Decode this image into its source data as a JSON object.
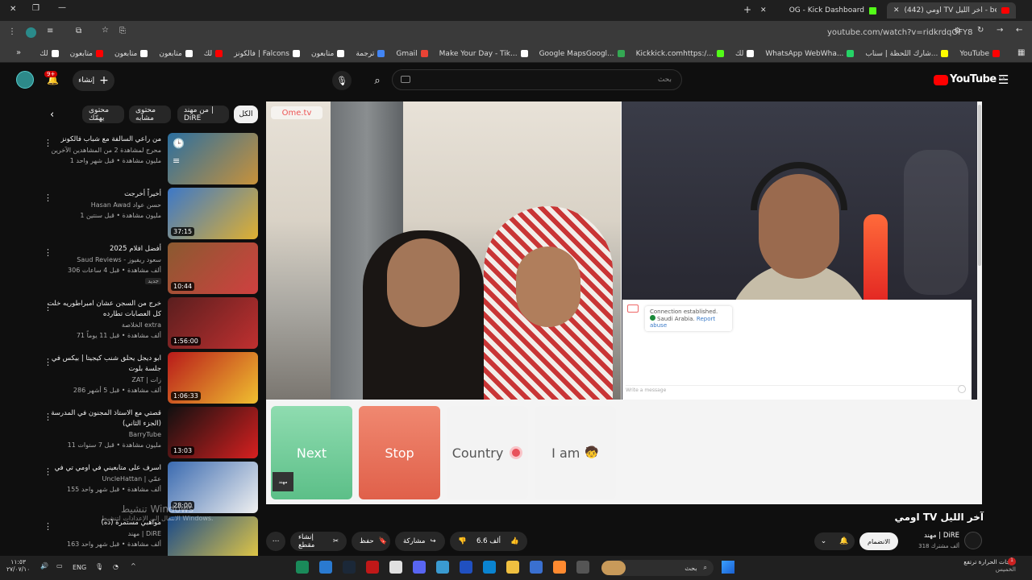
{
  "tabs": [
    {
      "label": "(442) اومي TV آخر الليل - be",
      "active": true
    },
    {
      "label": "OG - Kick Dashboard",
      "active": false
    }
  ],
  "address": {
    "url": "youtube.com/watch?v=ridkrdqOFY8"
  },
  "bookmarks": [
    {
      "label": "YouTube",
      "color": "#ff0000"
    },
    {
      "label": "شارك اللحظة | سناب...",
      "color": "#fffc00"
    },
    {
      "label": "WhatsApp WebWha...",
      "color": "#25d366"
    },
    {
      "label": "لك",
      "color": "#ffffff"
    },
    {
      "label": "Kickkick.comhttps:/...",
      "color": "#53fc18"
    },
    {
      "label": "Google MapsGoogl...",
      "color": "#34a853"
    },
    {
      "label": "Make Your Day - Tik...",
      "color": "#ffffff"
    },
    {
      "label": "Gmail",
      "color": "#ea4335"
    },
    {
      "label": "ترجمة",
      "color": "#4285f4"
    },
    {
      "label": "متابعون",
      "color": "#ffffff"
    },
    {
      "label": "فالكونز | Falcons",
      "color": "#ffffff"
    },
    {
      "label": "لك",
      "color": "#ff0000"
    },
    {
      "label": "متابعون",
      "color": "#ffffff"
    },
    {
      "label": "متابعون",
      "color": "#ffffff"
    },
    {
      "label": "متابعون",
      "color": "#ff0000"
    },
    {
      "label": "لك",
      "color": "#ffffff"
    }
  ],
  "header": {
    "logo": "YouTube",
    "region": "SA",
    "search_placeholder": "بحث",
    "create_label": "إنشاء",
    "notif_count": "9+"
  },
  "chips": [
    {
      "label": "الكل",
      "selected": true
    },
    {
      "label": "من مهند | DiRE",
      "selected": false
    },
    {
      "label": "محتوى مشابه",
      "selected": false
    },
    {
      "label": "محتوى يهمّك",
      "selected": false
    }
  ],
  "recommendations": [
    {
      "title": "من راعي السالفة مع شباب فالكونز",
      "channel": "محرج لمشاهدة 2 من المشاهدين الآخرين",
      "meta": "1 مليون مشاهدة • قبل شهر واحد",
      "duration": "",
      "colors": [
        "#2b6fa0",
        "#c8923a"
      ]
    },
    {
      "title": "أخيراً أخرجت",
      "channel": "Hasan Awad حسن عواد",
      "meta": "1 مليون مشاهدة • قبل سنتين",
      "duration": "37:15",
      "colors": [
        "#3c78c8",
        "#e0b030"
      ]
    },
    {
      "title": "أفضل افلام 2025",
      "channel": "Saud Reviews - سعود ريفيوز",
      "meta": "306 ألف مشاهدة • قبل 4 ساعات",
      "badge": "جديد",
      "duration": "10:44",
      "colors": [
        "#8a5a30",
        "#d04040"
      ]
    },
    {
      "title": "خرج من السجن عشان امبراطوريه خلت كل العصابات تطارده",
      "channel": "الخلاصة extra",
      "meta": "71 ألف مشاهدة • قبل 11 يوماً",
      "duration": "1:56:00",
      "colors": [
        "#5a1e1e",
        "#c03030"
      ]
    },
    {
      "title": "ابو ديجل يحلق شنب كيجيتا | بيكس في جلسة بلوت",
      "channel": "ZAT | زات",
      "meta": "286 ألف مشاهدة • قبل 5 أشهر",
      "duration": "1:06:33",
      "colors": [
        "#b81a1a",
        "#f0c030"
      ]
    },
    {
      "title": "قصتي مع الاستاذ المجنون في المدرسة (الجزء الثاني)",
      "channel": "BarryTube",
      "meta": "11 مليون مشاهدة • قبل 7 سنوات",
      "duration": "13:03",
      "colors": [
        "#101010",
        "#d82020"
      ]
    },
    {
      "title": "اسرف على متابعيني في اومي تي في",
      "channel": "UncleHattan | عمّي",
      "meta": "155 ألف مشاهدة • قبل شهر واحد",
      "duration": "28:00",
      "colors": [
        "#3a6ab0",
        "#f0f0f0"
      ]
    },
    {
      "title": "مواهبي مستمرة (ده)",
      "channel": "مهند | DiRE",
      "meta": "163 ألف مشاهدة • قبل شهر واحد",
      "duration": "",
      "colors": [
        "#1a4a8a",
        "#f0d040"
      ]
    }
  ],
  "watermark": {
    "line1": "تنشيط Windows",
    "line2": "الانتقال إلى الإعدادات لتنشيط Windows."
  },
  "player": {
    "ome_logo": "Ome.tv",
    "buttons": {
      "next": "Next",
      "stop": "Stop",
      "country": "Country",
      "iam": "I am"
    },
    "stamp": "مهند",
    "chat": {
      "status": "Connection established.",
      "country": "Saudi Arabia.",
      "report": "Report abuse",
      "input_placeholder": "Write a message"
    }
  },
  "video": {
    "title": "اومي TV آخر الليل",
    "channel": "مهند | DiRE",
    "subs": "318 ألف مشترك",
    "join_label": "الانضمام",
    "like_count": "6.6 ألف",
    "share_label": "مشاركة",
    "save_label": "حفظ",
    "clip_label": "إنشاء مقطع"
  },
  "taskbar": {
    "weather_title": "درجات الحرارة ترتفع",
    "weather_sub": "الخميس",
    "search": "بحث",
    "lang": "ENG",
    "time": "١١:٥٣",
    "date": "٢٧/٠٧/١٠"
  }
}
